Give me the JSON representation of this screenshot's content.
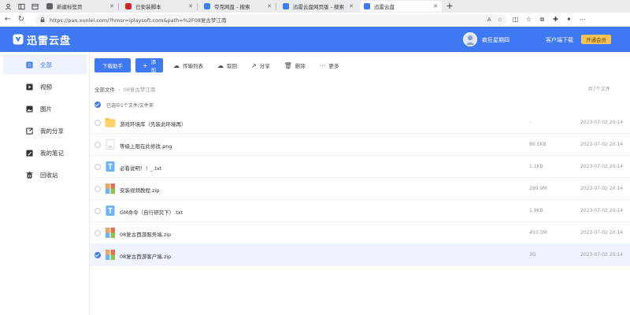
{
  "browser": {
    "tabs": [
      {
        "label": "新建标签页",
        "favicon_color": "#5f6368",
        "active": false
      },
      {
        "label": "已安装脚本",
        "favicon_color": "#cc2b2b",
        "active": false
      },
      {
        "label": "夸克网盘 - 搜索",
        "favicon_color": "#3b82f6",
        "active": false
      },
      {
        "label": "迅雷云盘网页版 - 搜索",
        "favicon_color": "#3b82f6",
        "active": false
      },
      {
        "label": "迅雷云盘",
        "favicon_color": "#3e78f2",
        "active": true
      }
    ],
    "address": "https://pan.xunlei.com/?hmsr=iplaysoft.com&path=%2F08复古梦江南",
    "new_tab": "+"
  },
  "header": {
    "logo_text": "迅雷云盘",
    "user_name": "疯狂星期四",
    "client_download": "客户端下载",
    "vip_button": "开通会员",
    "brand_color": "#3e78f2"
  },
  "sidebar": {
    "items": [
      {
        "label": "全部",
        "icon": "list-icon",
        "active": true
      },
      {
        "label": "视频",
        "icon": "video-icon",
        "active": false
      },
      {
        "label": "图片",
        "icon": "image-icon",
        "active": false
      },
      {
        "label": "我的分享",
        "icon": "share-icon",
        "active": false
      },
      {
        "label": "我的笔记",
        "icon": "note-icon",
        "active": false
      },
      {
        "label": "回收站",
        "icon": "trash-icon",
        "active": false
      }
    ]
  },
  "toolbar": {
    "download_label": "下载助手",
    "add_label": "添加",
    "transfer_label": "传输列表",
    "retrieve_label": "取回",
    "share_label": "分享",
    "delete_label": "删除",
    "more_label": "更多"
  },
  "breadcrumb": {
    "root": "全部文件",
    "current": "08复古梦江南"
  },
  "total_count": "共7个文件",
  "selection_text": "已选中1个文件/文件夹",
  "files": [
    {
      "name": "游戏环境库（先装此环境再）",
      "size": "-",
      "date": "2023-07-02 20:14",
      "type": "folder",
      "selected": false
    },
    {
      "name": "等级上限在此修改.png",
      "size": "86.5KB",
      "date": "2023-07-02 20:14",
      "type": "image",
      "selected": false
    },
    {
      "name": "必看说明！！_.txt",
      "size": "1.1KB",
      "date": "2023-07-02 20:14",
      "type": "text",
      "selected": false
    },
    {
      "name": "安装视频教程.zip",
      "size": "289.9M",
      "date": "2023-07-02 20:14",
      "type": "zip",
      "selected": false
    },
    {
      "name": "GM命令（自行研究下）.txt",
      "size": "1.9KB",
      "date": "2023-07-02 20:14",
      "type": "text",
      "selected": false
    },
    {
      "name": "08复古西游服务端.zip",
      "size": "493.3M",
      "date": "2023-07-02 20:14",
      "type": "zip",
      "selected": false
    },
    {
      "name": "08复古西游客户端.zip",
      "size": "3G",
      "date": "2023-07-02 20:14",
      "type": "zip",
      "selected": true
    }
  ]
}
